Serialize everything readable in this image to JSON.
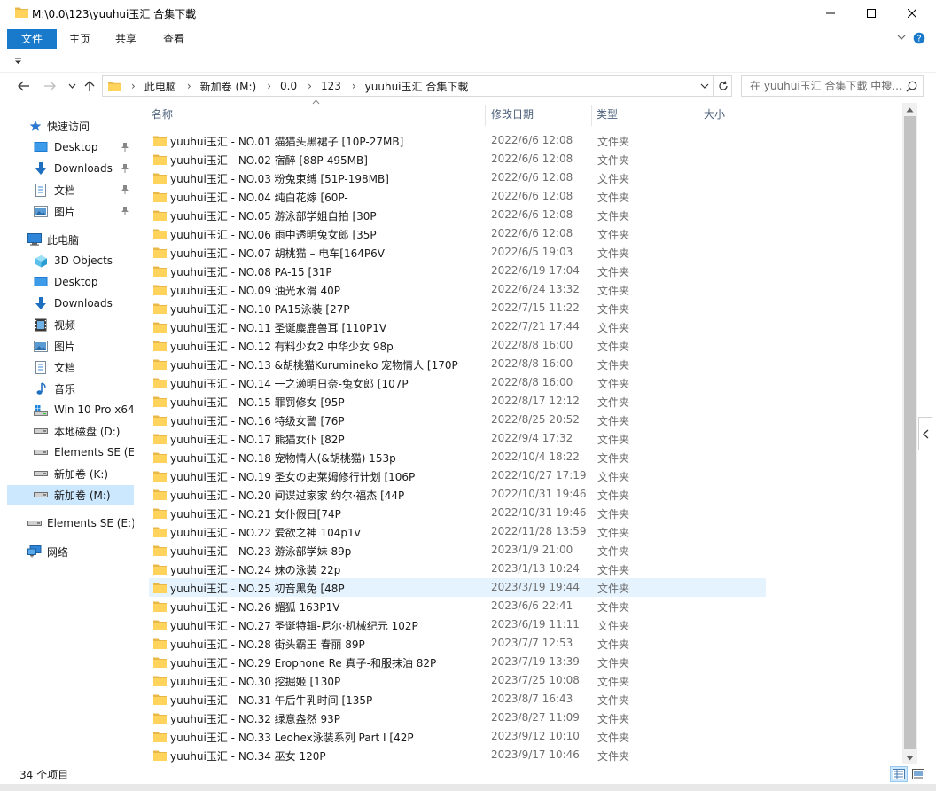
{
  "window": {
    "title": "M:\\0.0\\123\\yuuhui玉汇 合集下載"
  },
  "ribbon": {
    "tabs": [
      "文件",
      "主页",
      "共享",
      "查看"
    ]
  },
  "address": {
    "crumbs": [
      "此电脑",
      "新加卷 (M:)",
      "0.0",
      "123",
      "yuuhui玉汇 合集下載"
    ],
    "search_placeholder": "在 yuuhui玉汇 合集下載 中搜..."
  },
  "nav": {
    "quick_access": "快速访问",
    "quick_items": [
      {
        "label": "Desktop",
        "icon": "desktop-icon"
      },
      {
        "label": "Downloads",
        "icon": "download-icon"
      },
      {
        "label": "文档",
        "icon": "document-icon"
      },
      {
        "label": "图片",
        "icon": "pictures-icon"
      }
    ],
    "this_pc": "此电脑",
    "pc_items": [
      {
        "label": "3D Objects",
        "icon": "3d-objects-icon"
      },
      {
        "label": "Desktop",
        "icon": "desktop-icon"
      },
      {
        "label": "Downloads",
        "icon": "download-icon"
      },
      {
        "label": "视频",
        "icon": "video-icon"
      },
      {
        "label": "图片",
        "icon": "pictures-icon"
      },
      {
        "label": "文档",
        "icon": "document-icon"
      },
      {
        "label": "音乐",
        "icon": "music-icon"
      },
      {
        "label": "Win 10 Pro x64",
        "icon": "system-drive-icon"
      },
      {
        "label": "本地磁盘 (D:)",
        "icon": "drive-icon"
      },
      {
        "label": "Elements SE (E:)",
        "icon": "drive-icon"
      },
      {
        "label": "新加卷 (K:)",
        "icon": "drive-icon"
      },
      {
        "label": "新加卷 (M:)",
        "icon": "drive-icon"
      }
    ],
    "external": "Elements SE (E:)",
    "network": "网络"
  },
  "columns": {
    "name": "名称",
    "date": "修改日期",
    "type": "类型",
    "size": "大小"
  },
  "files": [
    {
      "name": "yuuhui玉汇 - NO.01 猫猫头黑裙子 [10P-27MB]",
      "date": "2022/6/6 12:08",
      "type": "文件夹"
    },
    {
      "name": "yuuhui玉汇 - NO.02 宿醉 [88P-495MB]",
      "date": "2022/6/6 12:08",
      "type": "文件夹"
    },
    {
      "name": "yuuhui玉汇 - NO.03 粉兔束缚 [51P-198MB]",
      "date": "2022/6/6 12:08",
      "type": "文件夹"
    },
    {
      "name": "yuuhui玉汇 - NO.04 纯白花嫁 [60P-",
      "date": "2022/6/6 12:08",
      "type": "文件夹"
    },
    {
      "name": "yuuhui玉汇 - NO.05 游泳部学姐自拍 [30P",
      "date": "2022/6/6 12:08",
      "type": "文件夹"
    },
    {
      "name": "yuuhui玉汇 - NO.06 雨中透明兔女郎 [35P",
      "date": "2022/6/6 12:08",
      "type": "文件夹"
    },
    {
      "name": "yuuhui玉汇 - NO.07 胡桃猫 – 电车[164P6V",
      "date": "2022/6/5 19:03",
      "type": "文件夹"
    },
    {
      "name": "yuuhui玉汇 - NO.08 PA-15 [31P",
      "date": "2022/6/19 17:04",
      "type": "文件夹"
    },
    {
      "name": "yuuhui玉汇 - NO.09 油光水滑 40P",
      "date": "2022/6/24 13:32",
      "type": "文件夹"
    },
    {
      "name": "yuuhui玉汇 - NO.10 PA15泳装 [27P",
      "date": "2022/7/15 11:22",
      "type": "文件夹"
    },
    {
      "name": "yuuhui玉汇 - NO.11 圣诞麋鹿兽耳 [110P1V",
      "date": "2022/7/21 17:44",
      "type": "文件夹"
    },
    {
      "name": "yuuhui玉汇 - NO.12 有料少女2 中华少女 98p",
      "date": "2022/8/8 16:00",
      "type": "文件夹"
    },
    {
      "name": "yuuhui玉汇 - NO.13 &胡桃猫Kurumineko 宠物情人 [170P",
      "date": "2022/8/8 16:00",
      "type": "文件夹"
    },
    {
      "name": "yuuhui玉汇 - NO.14 一之濑明日奈-兔女郎 [107P",
      "date": "2022/8/8 16:00",
      "type": "文件夹"
    },
    {
      "name": "yuuhui玉汇 - NO.15 罪罚修女 [95P",
      "date": "2022/8/17 12:12",
      "type": "文件夹"
    },
    {
      "name": "yuuhui玉汇 - NO.16 特级女警 [76P",
      "date": "2022/8/25 20:52",
      "type": "文件夹"
    },
    {
      "name": "yuuhui玉汇 - NO.17 熊猫女仆 [82P",
      "date": "2022/9/4 17:32",
      "type": "文件夹"
    },
    {
      "name": "yuuhui玉汇 - NO.18 宠物情人(&胡桃猫) 153p",
      "date": "2022/10/4 18:22",
      "type": "文件夹"
    },
    {
      "name": "yuuhui玉汇 - NO.19 圣女の史莱姆修行计划 [106P",
      "date": "2022/10/27 17:19",
      "type": "文件夹"
    },
    {
      "name": "yuuhui玉汇 - NO.20 间谍过家家 约尔·福杰 [44P",
      "date": "2022/10/31 19:46",
      "type": "文件夹"
    },
    {
      "name": "yuuhui玉汇 - NO.21 女仆假日[74P",
      "date": "2022/10/31 19:46",
      "type": "文件夹"
    },
    {
      "name": "yuuhui玉汇 - NO.22 爱欲之神 104p1v",
      "date": "2022/11/28 13:59",
      "type": "文件夹"
    },
    {
      "name": "yuuhui玉汇 - NO.23 游泳部学妹 89p",
      "date": "2023/1/9 21:00",
      "type": "文件夹"
    },
    {
      "name": "yuuhui玉汇 - NO.24 妹の泳装 22p",
      "date": "2023/1/13 10:24",
      "type": "文件夹"
    },
    {
      "name": "yuuhui玉汇 - NO.25 初音黑兔 [48P",
      "date": "2023/3/19 19:44",
      "type": "文件夹"
    },
    {
      "name": "yuuhui玉汇 - NO.26 媚狐 163P1V",
      "date": "2023/6/6 22:41",
      "type": "文件夹"
    },
    {
      "name": "yuuhui玉汇 - NO.27 圣诞特辑-尼尔·机械纪元 102P",
      "date": "2023/6/19 11:11",
      "type": "文件夹"
    },
    {
      "name": "yuuhui玉汇 - NO.28 街头霸王 春丽 89P",
      "date": "2023/7/7 12:53",
      "type": "文件夹"
    },
    {
      "name": "yuuhui玉汇 - NO.29 Erophone Re 真子-和服抹油 82P",
      "date": "2023/7/19 13:39",
      "type": "文件夹"
    },
    {
      "name": "yuuhui玉汇 - NO.30 挖掘姬 [130P",
      "date": "2023/7/25 10:08",
      "type": "文件夹"
    },
    {
      "name": "yuuhui玉汇 - NO.31 午后牛乳时间 [135P",
      "date": "2023/8/7 16:43",
      "type": "文件夹"
    },
    {
      "name": "yuuhui玉汇 - NO.32 绿意盎然 93P",
      "date": "2023/8/27 11:09",
      "type": "文件夹"
    },
    {
      "name": "yuuhui玉汇 - NO.33 Leohex泳装系列 Part I [42P",
      "date": "2023/9/12 10:10",
      "type": "文件夹"
    },
    {
      "name": "yuuhui玉汇 - NO.34 巫女 120P",
      "date": "2023/9/17 10:46",
      "type": "文件夹"
    }
  ],
  "hover_index": 24,
  "status": {
    "count": "34 个项目"
  },
  "colors": {
    "accent": "#1979ca",
    "folder": "#ffd35c",
    "folder_dark": "#e8b84a",
    "selected": "#cce8ff",
    "hover": "#e5f3ff"
  }
}
